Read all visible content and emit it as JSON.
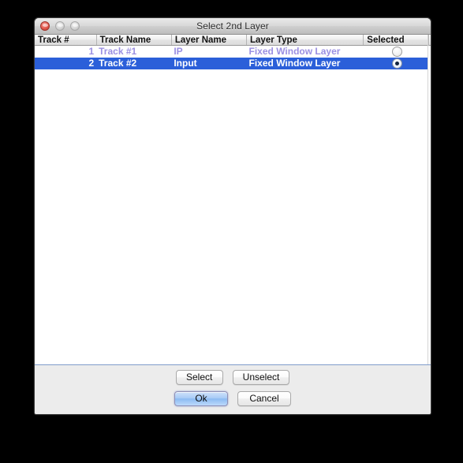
{
  "window": {
    "title": "Select 2nd Layer",
    "controls": {
      "close": "close-button",
      "minimize": "minimize-button",
      "zoom": "zoom-button"
    }
  },
  "table": {
    "columns": [
      "Track #",
      "Track Name",
      "Layer Name",
      "Layer Type",
      "Selected"
    ],
    "rows": [
      {
        "track_number": "1",
        "track_name": "Track #1",
        "layer_name": "IP",
        "layer_type": "Fixed Window Layer",
        "selected": false,
        "state": "unselected",
        "radio_name": "row-1-selected-radio"
      },
      {
        "track_number": "2",
        "track_name": "Track #2",
        "layer_name": "Input",
        "layer_type": "Fixed Window Layer",
        "selected": true,
        "state": "selected",
        "radio_name": "row-2-selected-radio"
      }
    ]
  },
  "footer": {
    "select_label": "Select",
    "unselect_label": "Unselect",
    "ok_label": "Ok",
    "cancel_label": "Cancel"
  },
  "colors": {
    "selection_blue": "#2b5fd9",
    "dim_row_text": "#9b8fe2",
    "default_button_blue": "#8cbbf2",
    "window_chrome": "#ececec",
    "list_background": "#ffffff",
    "backdrop": "#000000"
  }
}
